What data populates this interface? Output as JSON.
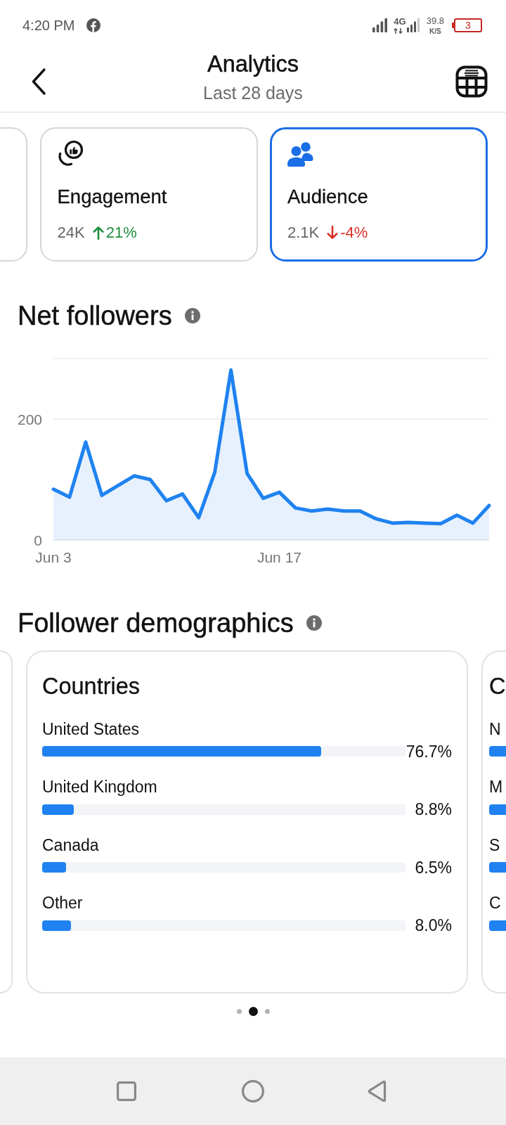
{
  "status_bar": {
    "time": "4:20 PM",
    "network": "4G",
    "speed": "39.8",
    "speed_unit": "K/S",
    "battery": "3",
    "battery_low": true
  },
  "header": {
    "title": "Analytics",
    "subtitle": "Last 28 days"
  },
  "metric_cards": [
    {
      "kind": "engagement",
      "title": "Engagement",
      "value": "24K",
      "change": "21%",
      "increase": true,
      "selected": false
    },
    {
      "kind": "audience",
      "title": "Audience",
      "value": "2.1K",
      "change": "-4%",
      "increase": false,
      "selected": true
    }
  ],
  "net_followers": {
    "title": "Net followers",
    "chart_data": {
      "type": "area",
      "categories": [
        "Jun 3",
        null,
        null,
        null,
        null,
        null,
        null,
        null,
        null,
        null,
        null,
        null,
        null,
        null,
        "Jun 17",
        null,
        null,
        null,
        null,
        null,
        null,
        null,
        null,
        null,
        null,
        null,
        null,
        null
      ],
      "ylim": [
        0,
        300
      ],
      "yticks": [
        0,
        200
      ],
      "series": [
        {
          "color": "#1f82f0",
          "values": [
            84,
            71,
            162,
            74,
            90,
            106,
            100,
            65,
            76,
            37,
            112,
            281,
            110,
            69,
            79,
            53,
            48,
            51,
            48,
            48,
            35,
            28,
            29,
            28,
            27,
            41,
            28,
            57
          ]
        }
      ]
    }
  },
  "follower_demographics": {
    "title": "Follower demographics",
    "cards": [
      {
        "kind": "full",
        "title": "Countries",
        "rows": [
          {
            "label": "United States",
            "level": 0.767,
            "value": "76.7%"
          },
          {
            "label": "United Kingdom",
            "level": 0.088,
            "value": "8.8%"
          },
          {
            "label": "Canada",
            "level": 0.065,
            "value": "6.5%"
          },
          {
            "label": "Other",
            "level": 0.08,
            "value": "8.0%"
          }
        ]
      },
      {
        "kind": "peek",
        "title": "C",
        "rows": [
          {
            "label": "N"
          },
          {
            "label": "M"
          },
          {
            "label": "S"
          },
          {
            "label": "C"
          }
        ]
      }
    ],
    "pager": [
      {
        "selected": false
      },
      {
        "selected": true
      },
      {
        "selected": false
      }
    ]
  }
}
